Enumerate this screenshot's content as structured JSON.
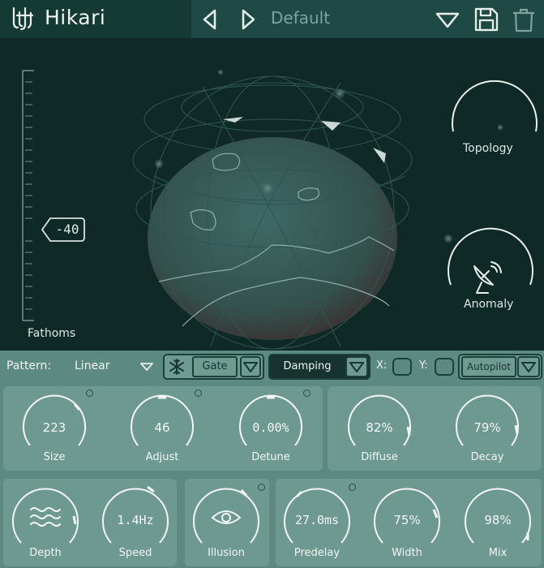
{
  "app": {
    "title": "Hikari"
  },
  "header": {
    "preset_name": "Default"
  },
  "visual": {
    "fathoms": {
      "label": "Fathoms",
      "value": "-40"
    },
    "topology": {
      "label": "Topology"
    },
    "anomaly": {
      "label": "Anomaly"
    }
  },
  "controls": {
    "pattern": {
      "label": "Pattern:",
      "value": "Linear"
    },
    "gate": {
      "label": "Gate"
    },
    "damping": {
      "label": "Damping"
    },
    "x_label": "X:",
    "y_label": "Y:",
    "autopilot": {
      "label": "Autopilot"
    },
    "knobs": {
      "size": {
        "label": "Size",
        "value": "223"
      },
      "adjust": {
        "label": "Adjust",
        "value": "46"
      },
      "detune": {
        "label": "Detune",
        "value": "0.00%"
      },
      "diffuse": {
        "label": "Diffuse",
        "value": "82%"
      },
      "decay": {
        "label": "Decay",
        "value": "79%"
      },
      "depth": {
        "label": "Depth"
      },
      "speed": {
        "label": "Speed",
        "value": "1.4Hz"
      },
      "illusion": {
        "label": "Illusion"
      },
      "predelay": {
        "label": "Predelay",
        "value": "27.0ms"
      },
      "width": {
        "label": "Width",
        "value": "75%"
      },
      "mix": {
        "label": "Mix",
        "value": "98%"
      }
    }
  },
  "icons": [
    "hikari-logo-icon",
    "prev-arrow-icon",
    "next-arrow-icon",
    "dropdown-icon",
    "save-icon",
    "trash-icon",
    "satellite-dish-icon",
    "snowflake-icon",
    "waves-icon",
    "eye-icon"
  ],
  "colors": {
    "background": "#0f2a26",
    "header": "#153a34",
    "panel": "#5d8a80",
    "group": "#6e9990",
    "accent": "#eef5f2"
  }
}
